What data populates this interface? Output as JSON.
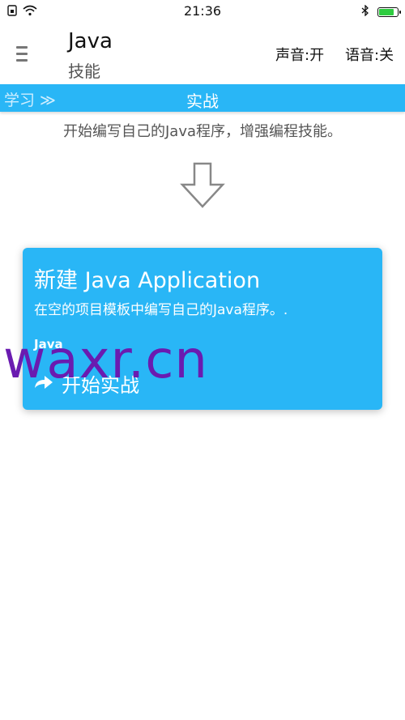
{
  "status_bar": {
    "time": "21:36",
    "battery_level": 0.85,
    "icons": [
      "sim-icon",
      "wifi-icon",
      "bluetooth-icon",
      "battery-icon"
    ]
  },
  "header": {
    "title": "Java",
    "subtitle": "技能",
    "sound_label": "声音:开",
    "voice_label": "语音:关"
  },
  "tab_bar": {
    "left_label": "学习 ≫",
    "title": "实战"
  },
  "description": "开始编写自己的Java程序，增强编程技能。",
  "card": {
    "title": "新建 Java Application",
    "description": "在空的项目模板中编写自己的Java程序。.",
    "logo_text": "Java",
    "action_label": "开始实战"
  },
  "watermark": "waxr.cn",
  "colors": {
    "accent": "#29b6f6",
    "watermark": "#6a1bb0",
    "battery": "#2ecc40"
  }
}
